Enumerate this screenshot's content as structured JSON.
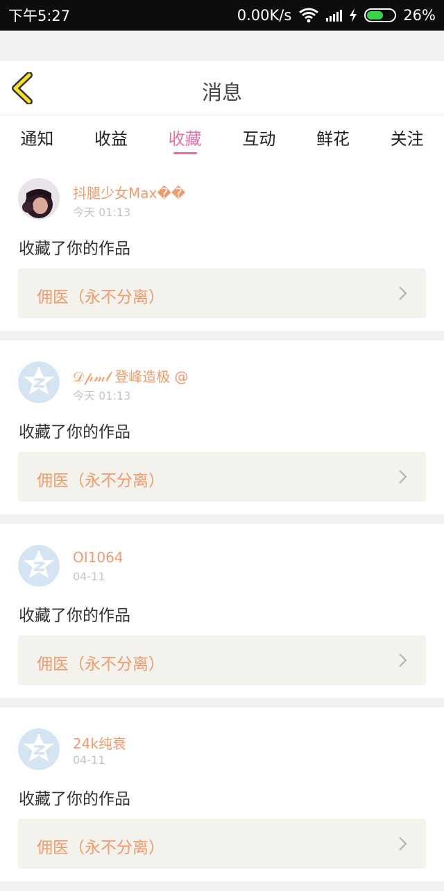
{
  "status_bar": {
    "time": "下午5:27",
    "net_speed": "0.00K/s",
    "battery": "26%",
    "battery_level": 0.6
  },
  "header": {
    "title": "消息"
  },
  "tabs": [
    {
      "label": "通知"
    },
    {
      "label": "收益"
    },
    {
      "label": "收藏",
      "active": true
    },
    {
      "label": "互动"
    },
    {
      "label": "鲜花"
    },
    {
      "label": "关注"
    }
  ],
  "items": [
    {
      "user": "抖腿少女Max��",
      "time": "今天 01:13",
      "action": "收藏了你的作品",
      "work": "佣医（永不分离）",
      "avatar": "photo-avatar"
    },
    {
      "user": "𝒟𝓅𝓂𝓁 登峰造极 @",
      "time": "今天 01:13",
      "action": "收藏了你的作品",
      "work": "佣医（永不分离）",
      "avatar": "qzone-star-avatar"
    },
    {
      "user": "OI1064",
      "time": "04-11",
      "action": "收藏了你的作品",
      "work": "佣医（永不分离）",
      "avatar": "qzone-star-avatar"
    },
    {
      "user": "24k纯衰",
      "time": "04-11",
      "action": "收藏了你的作品",
      "work": "佣医（永不分离）",
      "avatar": "qzone-star-avatar"
    }
  ],
  "colors": {
    "accent": "#e56fa7",
    "username": "#ef9b6d",
    "back_icon": "#f5e12a"
  },
  "icons": {
    "back": "chevron-left-icon",
    "item_arrow": "chevron-right-icon",
    "wifi": "wifi-icon",
    "signal": "signal-icon",
    "charging": "lightning-icon",
    "battery": "battery-icon"
  }
}
